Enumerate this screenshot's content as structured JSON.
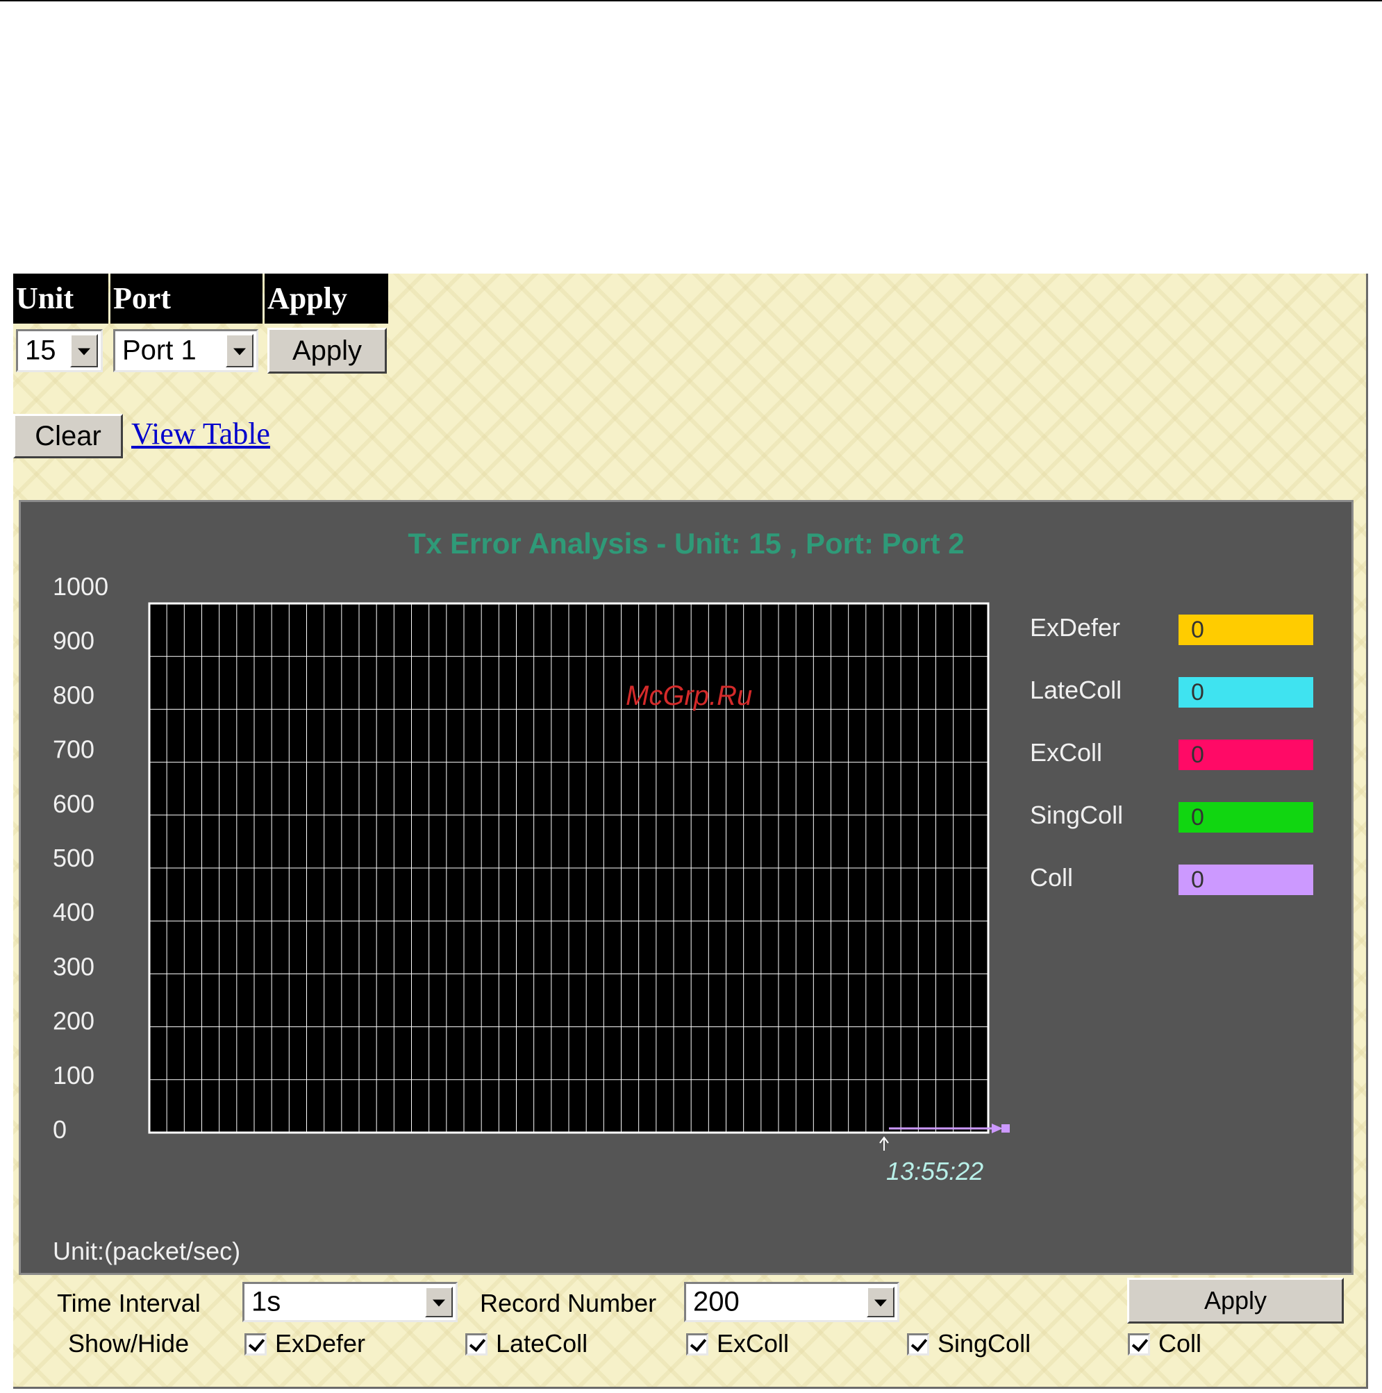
{
  "selector": {
    "unit_header": "Unit",
    "port_header": "Port",
    "apply_header": "Apply",
    "unit_value": "15",
    "port_value": "Port 1",
    "apply_label": "Apply"
  },
  "actions": {
    "clear_label": "Clear",
    "view_table_label": "View Table"
  },
  "chart_data": {
    "type": "line",
    "title": "Tx Error Analysis - Unit: 15 , Port: Port 2",
    "ylabel": "",
    "ylim": [
      0,
      1000
    ],
    "y_ticks": [
      "1000",
      "900",
      "800",
      "700",
      "600",
      "500",
      "400",
      "300",
      "200",
      "100",
      "0"
    ],
    "grid": true,
    "time_label": "13:55:22",
    "unit_text": "Unit:(packet/sec)",
    "legend_position": "right",
    "series": [
      {
        "name": "ExDefer",
        "value": "0",
        "color": "#ffcc00"
      },
      {
        "name": "LateColl",
        "value": "0",
        "color": "#3fe3f0"
      },
      {
        "name": "ExColl",
        "value": "0",
        "color": "#ff0a66"
      },
      {
        "name": "SingColl",
        "value": "0",
        "color": "#11d611"
      },
      {
        "name": "Coll",
        "value": "0",
        "color": "#cc99ff"
      }
    ]
  },
  "watermark": "McGrp.Ru",
  "controls": {
    "time_interval_label": "Time Interval",
    "time_interval_value": "1s",
    "record_number_label": "Record Number",
    "record_number_value": "200",
    "apply_label": "Apply",
    "show_hide_label": "Show/Hide",
    "checkboxes": [
      {
        "label": "ExDefer",
        "checked": true
      },
      {
        "label": "LateColl",
        "checked": true
      },
      {
        "label": "ExColl",
        "checked": true
      },
      {
        "label": "SingColl",
        "checked": true
      },
      {
        "label": "Coll",
        "checked": true
      }
    ]
  }
}
